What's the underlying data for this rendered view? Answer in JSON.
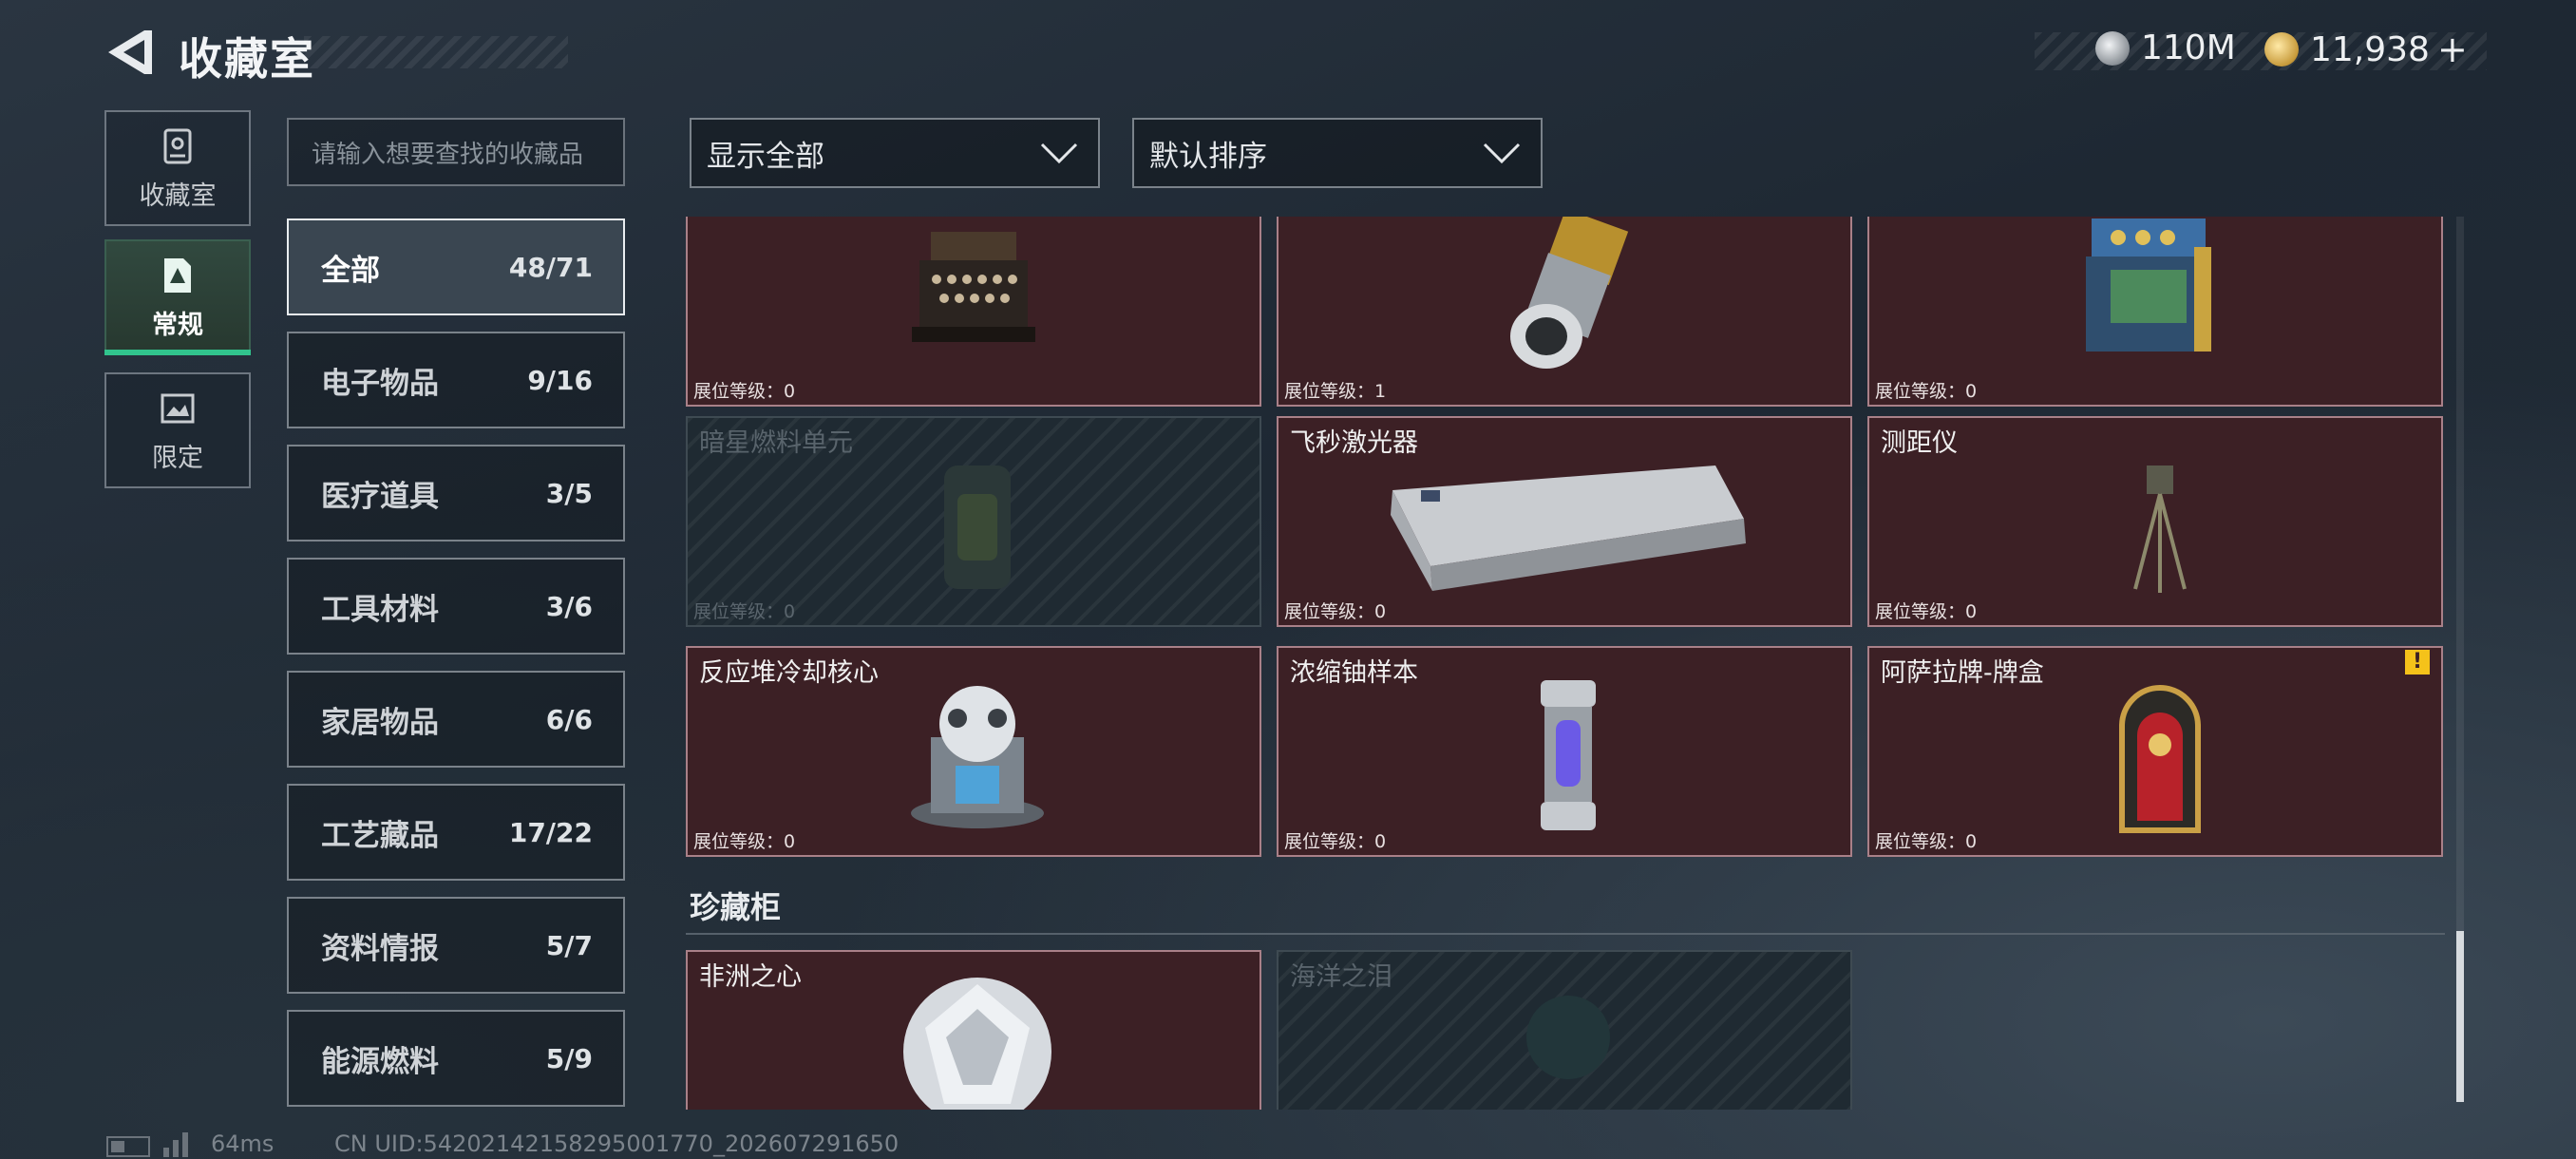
{
  "header": {
    "title": "收藏室",
    "currency": [
      {
        "icon": "silver-coin-icon",
        "amount": "110M"
      },
      {
        "icon": "gold-coin-icon",
        "amount": "11,938",
        "suffix": "+"
      }
    ]
  },
  "nav_tabs": [
    {
      "label": "收藏室",
      "icon": "collection-room-icon",
      "active": false
    },
    {
      "label": "常规",
      "icon": "regular-doc-icon",
      "active": true
    },
    {
      "label": "限定",
      "icon": "limited-image-icon",
      "active": false
    }
  ],
  "search": {
    "placeholder": "请输入想要查找的收藏品"
  },
  "categories": [
    {
      "name": "全部",
      "count": "48/71",
      "active": true
    },
    {
      "name": "电子物品",
      "count": "9/16"
    },
    {
      "name": "医疗道具",
      "count": "3/5"
    },
    {
      "name": "工具材料",
      "count": "3/6"
    },
    {
      "name": "家居物品",
      "count": "6/6"
    },
    {
      "name": "工艺藏品",
      "count": "17/22"
    },
    {
      "name": "资料情报",
      "count": "5/7"
    },
    {
      "name": "能源燃料",
      "count": "5/9"
    }
  ],
  "filters": {
    "show": "显示全部",
    "sort": "默认排序"
  },
  "items": [
    {
      "name": "",
      "level": "展位等级：0",
      "art": "typewriter"
    },
    {
      "name": "",
      "level": "展位等级：1",
      "art": "lens"
    },
    {
      "name": "",
      "level": "展位等级：0",
      "art": "machine"
    },
    {
      "name": "暗星燃料单元",
      "level": "展位等级：0",
      "locked": true,
      "art": "fuel"
    },
    {
      "name": "飞秒激光器",
      "level": "展位等级：0",
      "art": "laser"
    },
    {
      "name": "测距仪",
      "level": "展位等级：0",
      "art": "tripod"
    },
    {
      "name": "反应堆冷却核心",
      "level": "展位等级：0",
      "art": "reactor"
    },
    {
      "name": "浓缩铀样本",
      "level": "展位等级：0",
      "art": "capsule"
    },
    {
      "name": "阿萨拉牌-牌盒",
      "level": "展位等级：0",
      "art": "cardbox",
      "badge": "!"
    }
  ],
  "cabinet": {
    "title": "珍藏柜",
    "items": [
      {
        "name": "非洲之心",
        "art": "diamond"
      },
      {
        "name": "海洋之泪",
        "locked": true,
        "art": "tear"
      }
    ]
  },
  "footer": {
    "ping": "64ms",
    "uid": "CN UID:54202142158295001770_202607291650"
  }
}
